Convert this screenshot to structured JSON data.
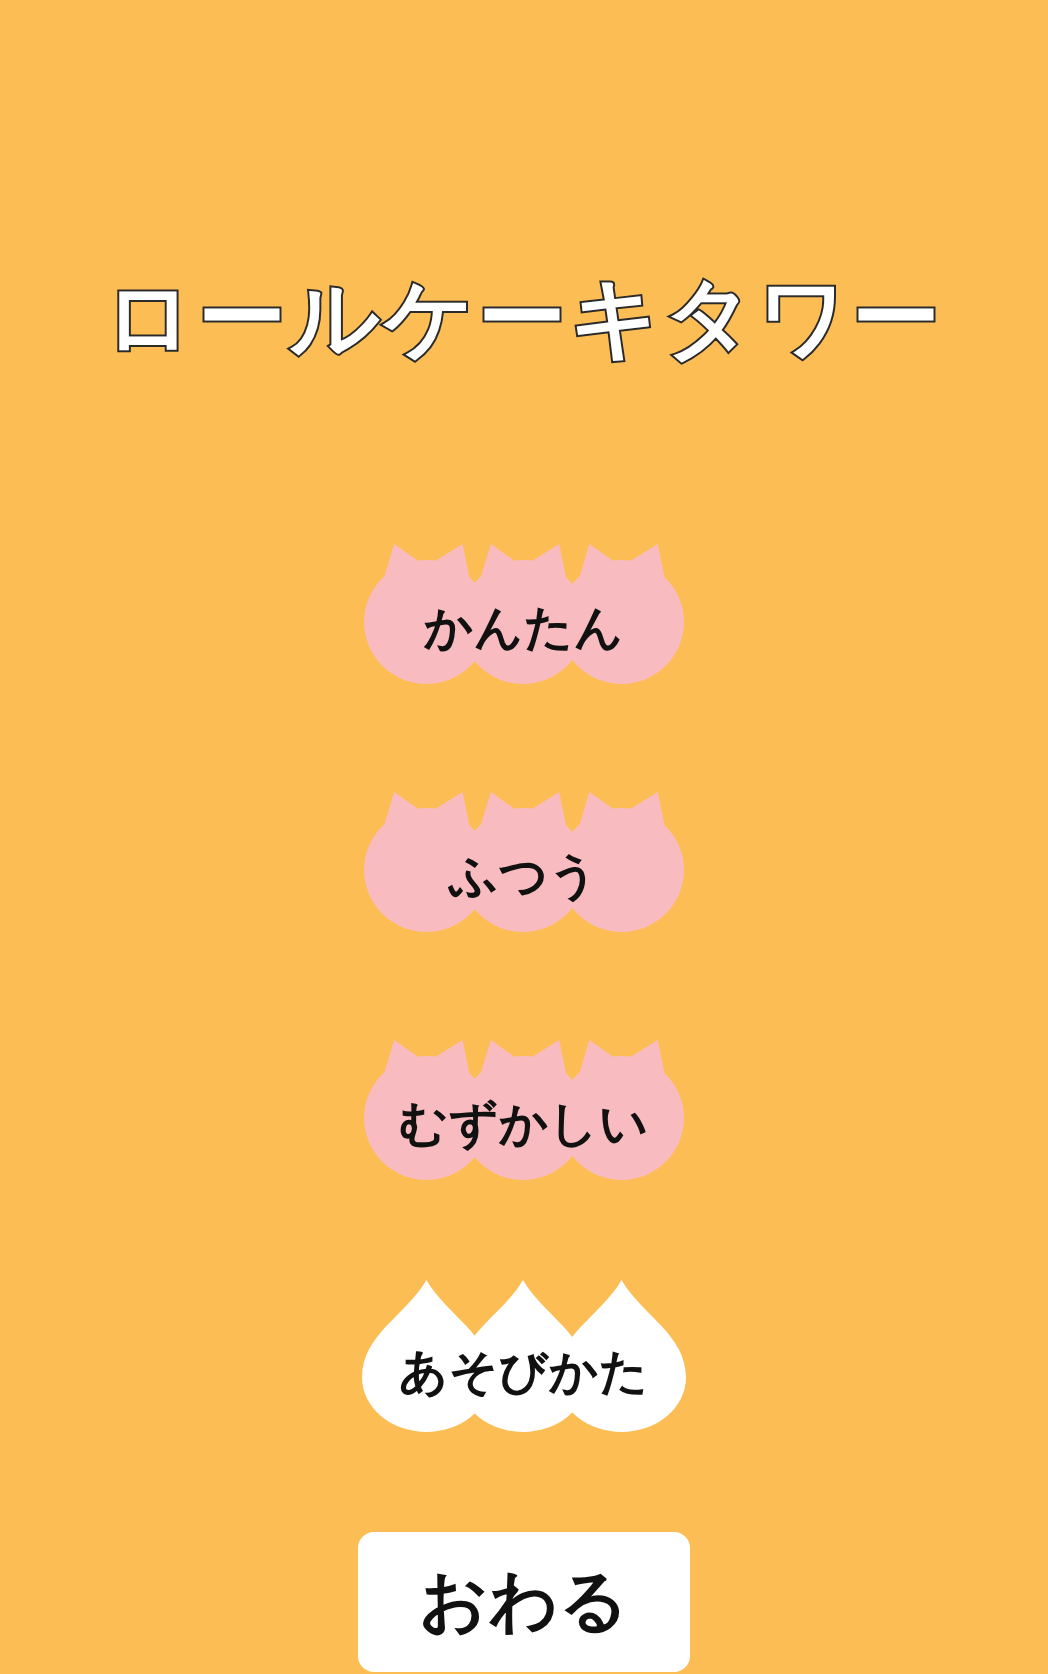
{
  "title": "ロールケーキタワー",
  "buttons": [
    {
      "label": "かんたん",
      "kind": "cat"
    },
    {
      "label": "ふつう",
      "kind": "cat"
    },
    {
      "label": "むずかしい",
      "kind": "cat"
    },
    {
      "label": "あそびかた",
      "kind": "drop"
    },
    {
      "label": "おわる",
      "kind": "plain"
    }
  ]
}
